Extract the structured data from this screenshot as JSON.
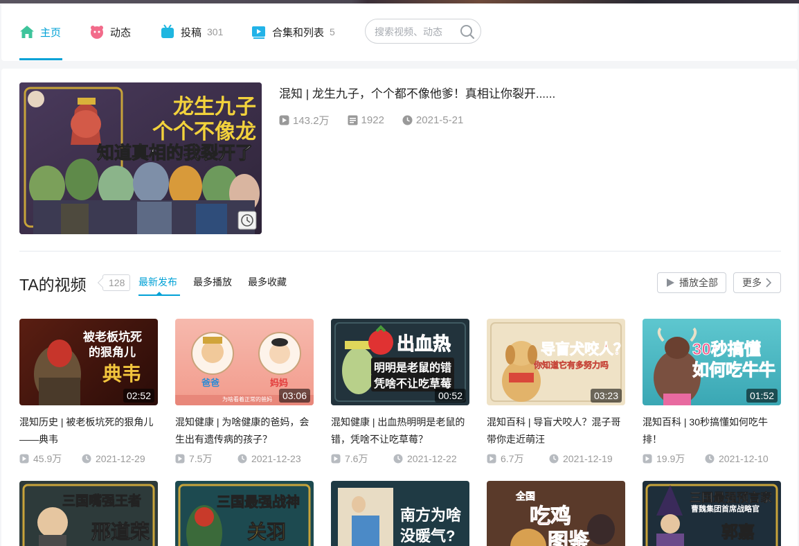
{
  "nav": {
    "items": [
      {
        "label": "主页",
        "count": "",
        "icon": "home-icon",
        "active": true
      },
      {
        "label": "动态",
        "count": "",
        "icon": "dynamic-icon",
        "active": false
      },
      {
        "label": "投稿",
        "count": "301",
        "icon": "upload-tv-icon",
        "active": false
      },
      {
        "label": "合集和列表",
        "count": "5",
        "icon": "playlist-icon",
        "active": false
      }
    ],
    "search_placeholder": "搜索视频、动态"
  },
  "featured": {
    "title": "混知 | 龙生九子，个个都不像他爹！真相让你裂开......",
    "plays": "143.2万",
    "danmaku": "1922",
    "date": "2021-5-21",
    "thumb_lines": [
      "龙生九子",
      "个个不像龙",
      "知道真相的我裂开了"
    ]
  },
  "videos_section": {
    "title": "TA的视频",
    "count": "128",
    "tabs": [
      "最新发布",
      "最多播放",
      "最多收藏"
    ],
    "active_tab": 0,
    "play_all": "播放全部",
    "more": "更多"
  },
  "videos": [
    {
      "title": "混知历史 | 被老板坑死的狠角儿——典韦",
      "duration": "02:52",
      "plays": "45.9万",
      "date": "2021-12-29",
      "thumb_text": [
        "被老板坑死",
        "的狠角儿",
        "典韦"
      ]
    },
    {
      "title": "混知健康 | 为啥健康的爸妈，会生出有遗传病的孩子？",
      "duration": "03:06",
      "plays": "7.5万",
      "date": "2021-12-23",
      "thumb_text": [
        "爸爸",
        "妈妈",
        "为啥看着正常的爸妈"
      ]
    },
    {
      "title": "混知健康 | 出血热明明是老鼠的错，凭啥不让吃草莓？",
      "duration": "00:52",
      "plays": "7.6万",
      "date": "2021-12-22",
      "thumb_text": [
        "出血热",
        "明明是老鼠的错",
        "凭啥不让吃草莓"
      ]
    },
    {
      "title": "混知百科 | 导盲犬咬人？混子哥带你走近萌汪",
      "duration": "03:23",
      "plays": "6.7万",
      "date": "2021-12-19",
      "thumb_text": [
        "导盲犬咬人？",
        "你知道它有多努力吗"
      ]
    },
    {
      "title": "混知百科 | 30秒搞懂如何吃牛排！",
      "duration": "01:52",
      "plays": "19.9万",
      "date": "2021-12-10",
      "thumb_text": [
        "30秒搞懂",
        "如何吃牛牛"
      ]
    }
  ],
  "videos_row2": [
    {
      "thumb_text": [
        "三国嘴强王者",
        "邢道荣"
      ]
    },
    {
      "thumb_text": [
        "三国最强战神",
        "关羽"
      ]
    },
    {
      "thumb_text": [
        "南方为啥",
        "没暖气?"
      ]
    },
    {
      "thumb_text": [
        "全国",
        "吃鸡",
        "图鉴"
      ]
    },
    {
      "thumb_text": [
        "三国最强预言家",
        "曹魏集团首席战略官",
        "郭嘉"
      ]
    }
  ]
}
